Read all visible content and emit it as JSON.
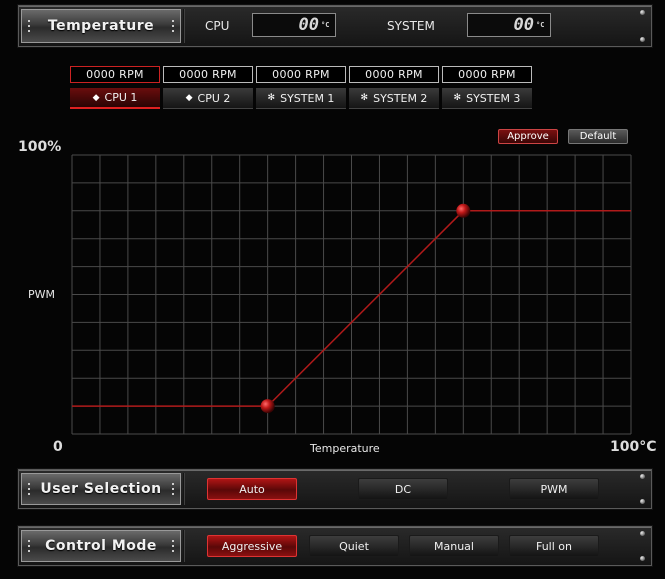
{
  "header": {
    "title": "Temperature",
    "cpu_label": "CPU",
    "cpu_value": "00",
    "cpu_unit": "°C",
    "system_label": "SYSTEM",
    "system_value": "00",
    "system_unit": "°C"
  },
  "fans": [
    {
      "rpm": "0000 RPM",
      "label": "CPU 1",
      "icon": "chip-icon",
      "active": true
    },
    {
      "rpm": "0000 RPM",
      "label": "CPU 2",
      "icon": "chip-icon",
      "active": false
    },
    {
      "rpm": "0000 RPM",
      "label": "SYSTEM 1",
      "icon": "fan-icon",
      "active": false
    },
    {
      "rpm": "0000 RPM",
      "label": "SYSTEM 2",
      "icon": "fan-icon",
      "active": false
    },
    {
      "rpm": "0000 RPM",
      "label": "SYSTEM 3",
      "icon": "fan-icon",
      "active": false
    }
  ],
  "actions": {
    "approve": "Approve",
    "default": "Default"
  },
  "chart_data": {
    "type": "line",
    "xlabel": "Temperature",
    "ylabel": "PWM",
    "y_max_label": "100%",
    "x_min_label": "0",
    "x_max_label": "100°C",
    "xlim": [
      0,
      100
    ],
    "ylim": [
      0,
      100
    ],
    "grid": true,
    "points": [
      {
        "x": 0,
        "y": 10
      },
      {
        "x": 35,
        "y": 10
      },
      {
        "x": 70,
        "y": 80
      },
      {
        "x": 100,
        "y": 80
      }
    ],
    "control_points": [
      {
        "x": 35,
        "y": 10
      },
      {
        "x": 70,
        "y": 80
      }
    ]
  },
  "user_selection": {
    "title": "User Selection",
    "options": [
      "Auto",
      "DC",
      "PWM"
    ],
    "selected": "Auto"
  },
  "control_mode": {
    "title": "Control Mode",
    "options": [
      "Aggressive",
      "Quiet",
      "Manual",
      "Full on"
    ],
    "selected": "Aggressive"
  },
  "colors": {
    "accent": "#c01818",
    "curve": "#b01a1a",
    "grid": "#4a4a4a",
    "background": "#050505"
  }
}
